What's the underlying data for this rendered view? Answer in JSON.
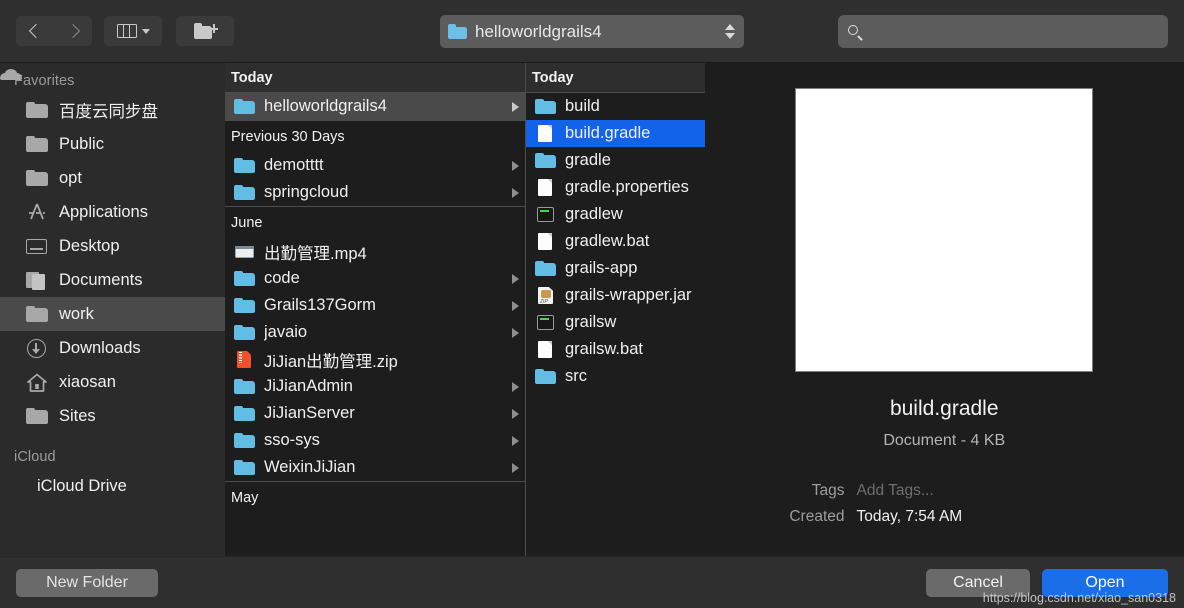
{
  "toolbar": {
    "back_icon": "chevron-left-icon",
    "forward_icon": "chevron-right-icon",
    "view_icon": "column-view-icon",
    "view_caret_icon": "chevron-down-icon",
    "new_folder_icon": "new-folder-icon",
    "path_popup": {
      "icon": "blue-folder-icon",
      "label": "helloworldgrails4",
      "stepper_icon": "up-down-stepper-icon"
    },
    "search": {
      "icon": "search-icon",
      "value": "",
      "placeholder": ""
    }
  },
  "sidebar": {
    "sections": [
      {
        "title": "Favorites",
        "items": [
          {
            "label": "百度云同步盘",
            "icon": "folder-icon",
            "selected": false
          },
          {
            "label": "Public",
            "icon": "folder-icon",
            "selected": false
          },
          {
            "label": "opt",
            "icon": "folder-icon",
            "selected": false
          },
          {
            "label": "Applications",
            "icon": "applications-icon",
            "selected": false
          },
          {
            "label": "Desktop",
            "icon": "desktop-icon",
            "selected": false
          },
          {
            "label": "Documents",
            "icon": "documents-icon",
            "selected": false
          },
          {
            "label": "work",
            "icon": "folder-icon",
            "selected": true
          },
          {
            "label": "Downloads",
            "icon": "downloads-icon",
            "selected": false
          },
          {
            "label": "xiaosan",
            "icon": "home-icon",
            "selected": false
          },
          {
            "label": "Sites",
            "icon": "folder-icon",
            "selected": false
          }
        ]
      },
      {
        "title": "iCloud",
        "items": [
          {
            "label": "iCloud Drive",
            "icon": "cloud-icon",
            "selected": false
          }
        ]
      }
    ]
  },
  "columns": [
    {
      "groups": [
        {
          "header": "Today",
          "header_style": "bar",
          "rows": [
            {
              "label": "helloworldgrails4",
              "icon": "blue-folder-icon",
              "disclosure": true,
              "selected": "grey"
            }
          ]
        },
        {
          "header": "Previous 30 Days",
          "header_style": "plain",
          "rows": [
            {
              "label": "demotttt",
              "icon": "blue-folder-icon",
              "disclosure": true,
              "selected": "none"
            },
            {
              "label": "springcloud",
              "icon": "blue-folder-icon",
              "disclosure": true,
              "selected": "none"
            }
          ]
        },
        {
          "header": "June",
          "header_style": "plain",
          "rows": [
            {
              "label": "出勤管理.mp4",
              "icon": "movie-icon",
              "disclosure": false,
              "selected": "none"
            },
            {
              "label": "code",
              "icon": "blue-folder-icon",
              "disclosure": true,
              "selected": "none"
            },
            {
              "label": "Grails137Gorm",
              "icon": "blue-folder-icon",
              "disclosure": true,
              "selected": "none"
            },
            {
              "label": "javaio",
              "icon": "blue-folder-icon",
              "disclosure": true,
              "selected": "none"
            },
            {
              "label": "JiJian出勤管理.zip",
              "icon": "zip-icon",
              "disclosure": false,
              "selected": "none"
            },
            {
              "label": "JiJianAdmin",
              "icon": "blue-folder-icon",
              "disclosure": true,
              "selected": "none"
            },
            {
              "label": "JiJianServer",
              "icon": "blue-folder-icon",
              "disclosure": true,
              "selected": "none"
            },
            {
              "label": "sso-sys",
              "icon": "blue-folder-icon",
              "disclosure": true,
              "selected": "none"
            },
            {
              "label": "WeixinJiJian",
              "icon": "blue-folder-icon",
              "disclosure": true,
              "selected": "none"
            }
          ]
        },
        {
          "header": "May",
          "header_style": "plain",
          "rows": []
        }
      ]
    },
    {
      "groups": [
        {
          "header": "Today",
          "header_style": "bar",
          "rows": [
            {
              "label": "build",
              "icon": "blue-folder-icon",
              "disclosure": true,
              "selected": "none"
            },
            {
              "label": "build.gradle",
              "icon": "document-icon",
              "disclosure": false,
              "selected": "blue"
            },
            {
              "label": "gradle",
              "icon": "blue-folder-icon",
              "disclosure": true,
              "selected": "none"
            },
            {
              "label": "gradle.properties",
              "icon": "document-icon",
              "disclosure": false,
              "selected": "none"
            },
            {
              "label": "gradlew",
              "icon": "terminal-icon",
              "disclosure": false,
              "selected": "none"
            },
            {
              "label": "gradlew.bat",
              "icon": "document-icon",
              "disclosure": false,
              "selected": "none"
            },
            {
              "label": "grails-app",
              "icon": "blue-folder-icon",
              "disclosure": true,
              "selected": "none"
            },
            {
              "label": "grails-wrapper.jar",
              "icon": "jar-icon",
              "disclosure": false,
              "selected": "none"
            },
            {
              "label": "grailsw",
              "icon": "terminal-icon",
              "disclosure": false,
              "selected": "none"
            },
            {
              "label": "grailsw.bat",
              "icon": "document-icon",
              "disclosure": false,
              "selected": "none"
            },
            {
              "label": "src",
              "icon": "blue-folder-icon",
              "disclosure": true,
              "selected": "none"
            }
          ]
        }
      ]
    }
  ],
  "preview": {
    "thumbnail": "blank-document-thumbnail",
    "name": "build.gradle",
    "kind": "Document - 4 KB",
    "metadata": [
      {
        "key": "Tags",
        "value": "Add Tags...",
        "muted": true
      },
      {
        "key": "Created",
        "value": "Today, 7:54 AM",
        "muted": false
      }
    ]
  },
  "footer": {
    "new_folder_label": "New Folder",
    "cancel_label": "Cancel",
    "open_label": "Open"
  },
  "watermark": "https://blog.csdn.net/xiao_san0318",
  "colors": {
    "selection_blue": "#1263ea",
    "open_button_blue": "#1a6fe8",
    "folder_blue": "#61bde4",
    "window_bg": "#1d1d1d",
    "chrome_bg": "#2f2f2f"
  }
}
